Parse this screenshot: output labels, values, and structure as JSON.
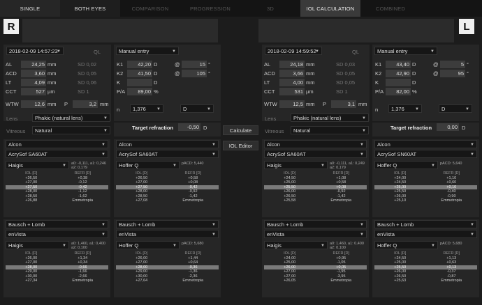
{
  "tabs": [
    "SINGLE",
    "BOTH EYES",
    "COMPARISON",
    "PROGRESSION",
    "3D",
    "IOL CALCULATION",
    "COMBINED"
  ],
  "right": {
    "eye": "R",
    "date": "2018-02-09 14:57:23",
    "ql": "QL",
    "source": "Manual entry",
    "al": "24,25",
    "acd": "3,60",
    "lt": "4,09",
    "cct": "527",
    "sd_al": "SD 0,02",
    "sd_acd": "SD 0,05",
    "sd_lt": "SD 0,06",
    "sd_cct": "SD 1",
    "k1": "42,20",
    "k2": "41,50",
    "k": "",
    "pa": "89,00",
    "k1_axis": "15",
    "k2_axis": "105",
    "wtw": "12,6",
    "p": "3,2",
    "n": "1,376",
    "dunit": "D",
    "lens": "Phakic (natural lens)",
    "vitreous": "Natural",
    "target": "-0,50",
    "calcs": [
      {
        "mfr": "Alcon",
        "iol": "AcrySof SA60AT",
        "formula": "Haigis",
        "consts": [
          "a0: -0,111, a1: 0,246",
          "a2: 0,179"
        ],
        "rows": [
          [
            "+26,50",
            "+0,38"
          ],
          [
            "+27,00",
            "-0,12"
          ],
          [
            "+27,50",
            "-0,42"
          ],
          [
            "+28,00",
            "-1,12"
          ],
          [
            "+28,50",
            "-1,62"
          ],
          [
            "+26,88",
            "Emmetropia"
          ]
        ],
        "hl": 2
      },
      {
        "mfr": "Alcon",
        "iol": "AcrySof SA60AT",
        "formula": "Hoffer Q",
        "consts": [
          "pACD: 5,440"
        ],
        "rows": [
          [
            "+26,50",
            "+0,58"
          ],
          [
            "+27,00",
            "+0,08"
          ],
          [
            "+27,50",
            "-0,42"
          ],
          [
            "+28,00",
            "-0,92"
          ],
          [
            "+28,50",
            "-1,42"
          ],
          [
            "+27,08",
            "Emmetropia"
          ]
        ],
        "hl": 2
      },
      {
        "mfr": "Bausch + Lomb",
        "iol": "enVista",
        "formula": "Haigis",
        "consts": [
          "a0: 1,460, a1: 0,400",
          "a2: 0,100"
        ],
        "rows": [
          [
            "+26,00",
            "+1,34"
          ],
          [
            "+27,00",
            "+0,34"
          ],
          [
            "+28,00",
            "-0,66"
          ],
          [
            "+29,00",
            "-1,66"
          ],
          [
            "+30,00",
            "-2,66"
          ],
          [
            "+27,34",
            "Emmetropia"
          ]
        ],
        "hl": 2
      },
      {
        "mfr": "Bausch + Lomb",
        "iol": "enVista",
        "formula": "Hoffer Q",
        "consts": [
          "pACD: 5,680"
        ],
        "rows": [
          [
            "+26,00",
            "+1,44"
          ],
          [
            "+27,00",
            "+0,64"
          ],
          [
            "+28,00",
            "-0,36"
          ],
          [
            "+29,00",
            "-1,36"
          ],
          [
            "+30,00",
            "-2,36"
          ],
          [
            "+27,64",
            "Emmetropia"
          ]
        ],
        "hl": 2
      }
    ]
  },
  "left": {
    "eye": "L",
    "date": "2018-02-09 14:59:52",
    "ql": "QL",
    "source": "Manual entry",
    "al": "24,18",
    "acd": "3,66",
    "lt": "4,00",
    "cct": "531",
    "sd_al": "SD 0,03",
    "sd_acd": "SD 0,05",
    "sd_lt": "SD 0,05",
    "sd_cct": "SD 1",
    "k1": "43,40",
    "k2": "42,90",
    "k": "",
    "pa": "82,00",
    "k1_axis": "5",
    "k2_axis": "95",
    "wtw": "12,5",
    "p": "3,1",
    "n": "1,376",
    "dunit": "D",
    "lens": "Phakic (natural lens)",
    "vitreous": "Natural",
    "target": "0,00",
    "calcs": [
      {
        "mfr": "Alcon",
        "iol": "AcrySof SA60AT",
        "formula": "Haigis",
        "consts": [
          "a0: -0,111, a1: 0,249",
          "a2: 0,179"
        ],
        "rows": [
          [
            "+24,50",
            "+1,08"
          ],
          [
            "+25,00",
            "+0,58"
          ],
          [
            "+25,50",
            "+0,08"
          ],
          [
            "+26,00",
            "-0,92"
          ],
          [
            "+26,50",
            "-1,42"
          ],
          [
            "+25,58",
            "Emmetropia"
          ]
        ],
        "hl": 2
      },
      {
        "mfr": "Alcon",
        "iol": "AcrySof SN60AT",
        "formula": "Hoffer Q",
        "consts": [
          "pACD: 5,640"
        ],
        "rows": [
          [
            "+24,00",
            "+1,10"
          ],
          [
            "+24,50",
            "+0,60"
          ],
          [
            "+25,00",
            "+0,10"
          ],
          [
            "+25,50",
            "-0,40"
          ],
          [
            "+26,00",
            "-0,90"
          ],
          [
            "+25,10",
            "Emmetropia"
          ]
        ],
        "hl": 2
      },
      {
        "mfr": "Bausch + Lomb",
        "iol": "enVista",
        "formula": "Haigis",
        "consts": [
          "a0: 1,460, a1: 0,400",
          "a2: 0,100"
        ],
        "rows": [
          [
            "+24,00",
            "+0,95"
          ],
          [
            "+25,00",
            "-1,05"
          ],
          [
            "+26,00",
            "+0,05"
          ],
          [
            "+27,00",
            "-1,95"
          ],
          [
            "+27,00",
            "-3,95"
          ],
          [
            "+26,05",
            "Emmetropia"
          ]
        ],
        "hl": 2
      },
      {
        "mfr": "Bausch + Lomb",
        "iol": "enVista",
        "formula": "Hoffer Q",
        "consts": [
          "pACD: 5,680"
        ],
        "rows": [
          [
            "+24,50",
            "+1,13"
          ],
          [
            "+25,00",
            "+0,63"
          ],
          [
            "+25,50",
            "+0,13"
          ],
          [
            "+26,00",
            "-0,37"
          ],
          [
            "+26,50",
            "-0,87"
          ],
          [
            "+25,63",
            "Emmetropia"
          ]
        ],
        "hl": 2
      }
    ]
  },
  "buttons": {
    "calculate": "Calculate",
    "editor": "IOL Editor"
  },
  "labels": {
    "al": "AL",
    "acd": "ACD",
    "lt": "LT",
    "cct": "CCT",
    "k1": "K1",
    "k2": "K2",
    "k": "K",
    "pa": "P/A",
    "wtw": "WTW",
    "p": "P",
    "n": "n",
    "lens": "Lens",
    "vitreous": "Vitreous",
    "target": "Target refraction",
    "iol_col": "IOL [D]",
    "refr_col": "REFR [D]",
    "mm": "mm",
    "um": "µm",
    "d": "D",
    "pct": "%",
    "at": "@",
    "deg": "°"
  }
}
